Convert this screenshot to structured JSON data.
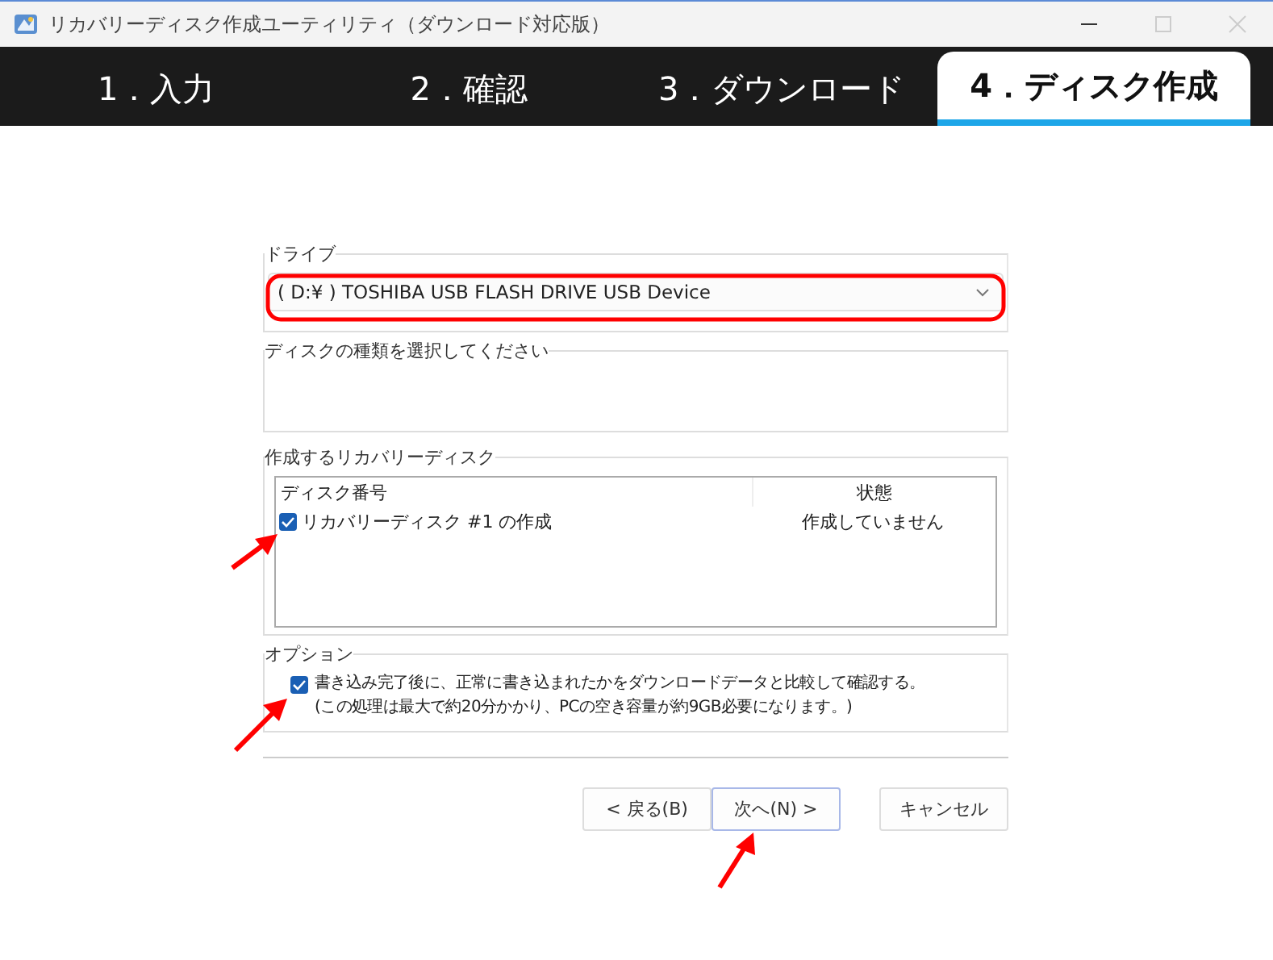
{
  "window": {
    "title": "リカバリーディスク作成ユーティリティ（ダウンロード対応版）"
  },
  "tabs": [
    {
      "label": "1．入力",
      "selected": false
    },
    {
      "label": "2．確認",
      "selected": false
    },
    {
      "label": "3．ダウンロード",
      "selected": false
    },
    {
      "label": "4．ディスク作成",
      "selected": true
    }
  ],
  "drive": {
    "label": "ドライブ",
    "value": "( D:¥ ) TOSHIBA USB FLASH DRIVE USB Device"
  },
  "disk_type": {
    "label": "ディスクの種類を選択してください"
  },
  "recovery_disks": {
    "label": "作成するリカバリーディスク",
    "columns": [
      "ディスク番号",
      "状態"
    ],
    "rows": [
      {
        "name": "リカバリーディスク #1 の作成",
        "status": "作成していません",
        "checked": true
      }
    ]
  },
  "options": {
    "label": "オプション",
    "items": [
      {
        "line1": "書き込み完了後に、正常に書き込まれたかをダウンロードデータと比較して確認する。",
        "line2": "(この処理は最大で約20分かかり、PCの空き容量が約9GB必要になります。)",
        "checked": true
      }
    ]
  },
  "buttons": [
    {
      "label": "< 戻る(B)",
      "default": false
    },
    {
      "label": "次へ(N) >",
      "default": true
    },
    {
      "label": "キャンセル",
      "default": false
    }
  ]
}
